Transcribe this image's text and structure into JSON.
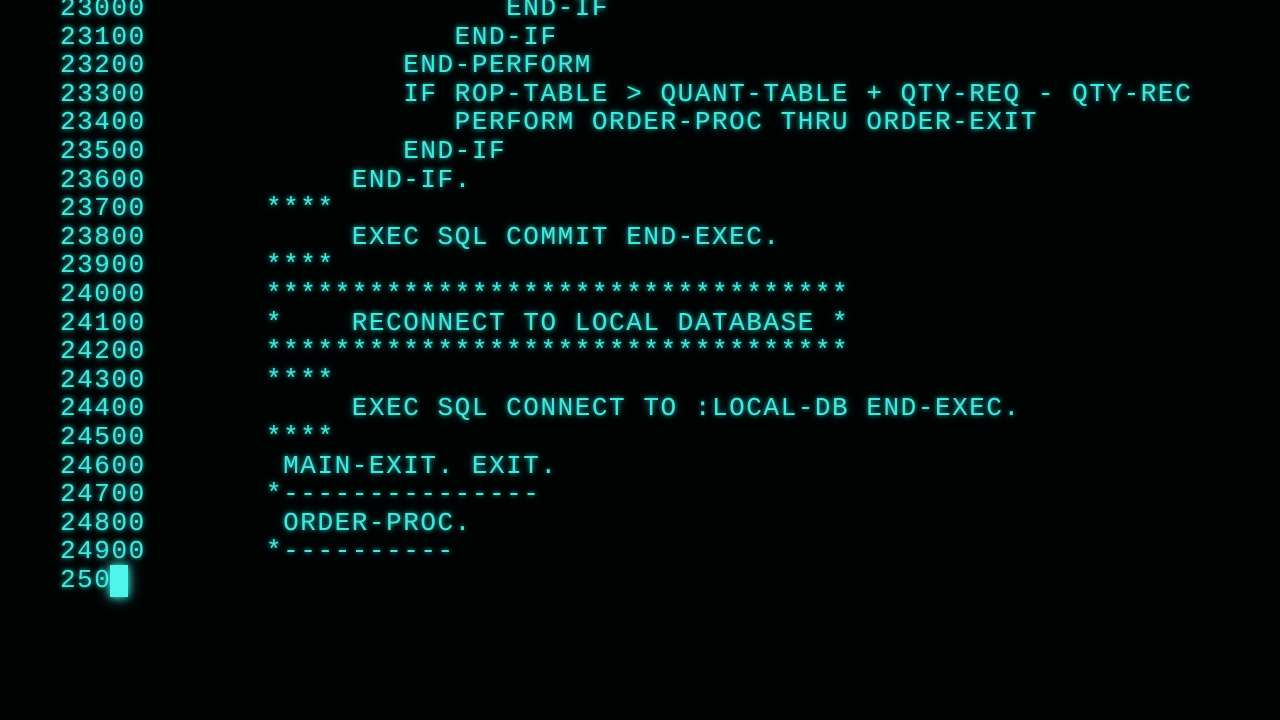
{
  "terminal": {
    "accent_color": "#45e6dc",
    "cursor_icon": "block-cursor",
    "lines": [
      {
        "num": "23000",
        "code": "              END-IF"
      },
      {
        "num": "23100",
        "code": "           END-IF"
      },
      {
        "num": "23200",
        "code": "        END-PERFORM"
      },
      {
        "num": "23300",
        "code": "        IF ROP-TABLE > QUANT-TABLE + QTY-REQ - QTY-REC"
      },
      {
        "num": "23400",
        "code": "           PERFORM ORDER-PROC THRU ORDER-EXIT"
      },
      {
        "num": "23500",
        "code": "        END-IF"
      },
      {
        "num": "23600",
        "code": "     END-IF."
      },
      {
        "num": "23700",
        "code": "****"
      },
      {
        "num": "23800",
        "code": "     EXEC SQL COMMIT END-EXEC."
      },
      {
        "num": "23900",
        "code": "****"
      },
      {
        "num": "24000",
        "code": "**********************************"
      },
      {
        "num": "24100",
        "code": "*    RECONNECT TO LOCAL DATABASE *"
      },
      {
        "num": "24200",
        "code": "**********************************"
      },
      {
        "num": "24300",
        "code": "****"
      },
      {
        "num": "24400",
        "code": "     EXEC SQL CONNECT TO :LOCAL-DB END-EXEC."
      },
      {
        "num": "24500",
        "code": "****"
      },
      {
        "num": "24600",
        "code": " MAIN-EXIT. EXIT."
      },
      {
        "num": "24700",
        "code": "*---------------"
      },
      {
        "num": "24800",
        "code": " ORDER-PROC."
      },
      {
        "num": "24900",
        "code": "*----------"
      },
      {
        "num": "250",
        "code": ""
      }
    ]
  }
}
